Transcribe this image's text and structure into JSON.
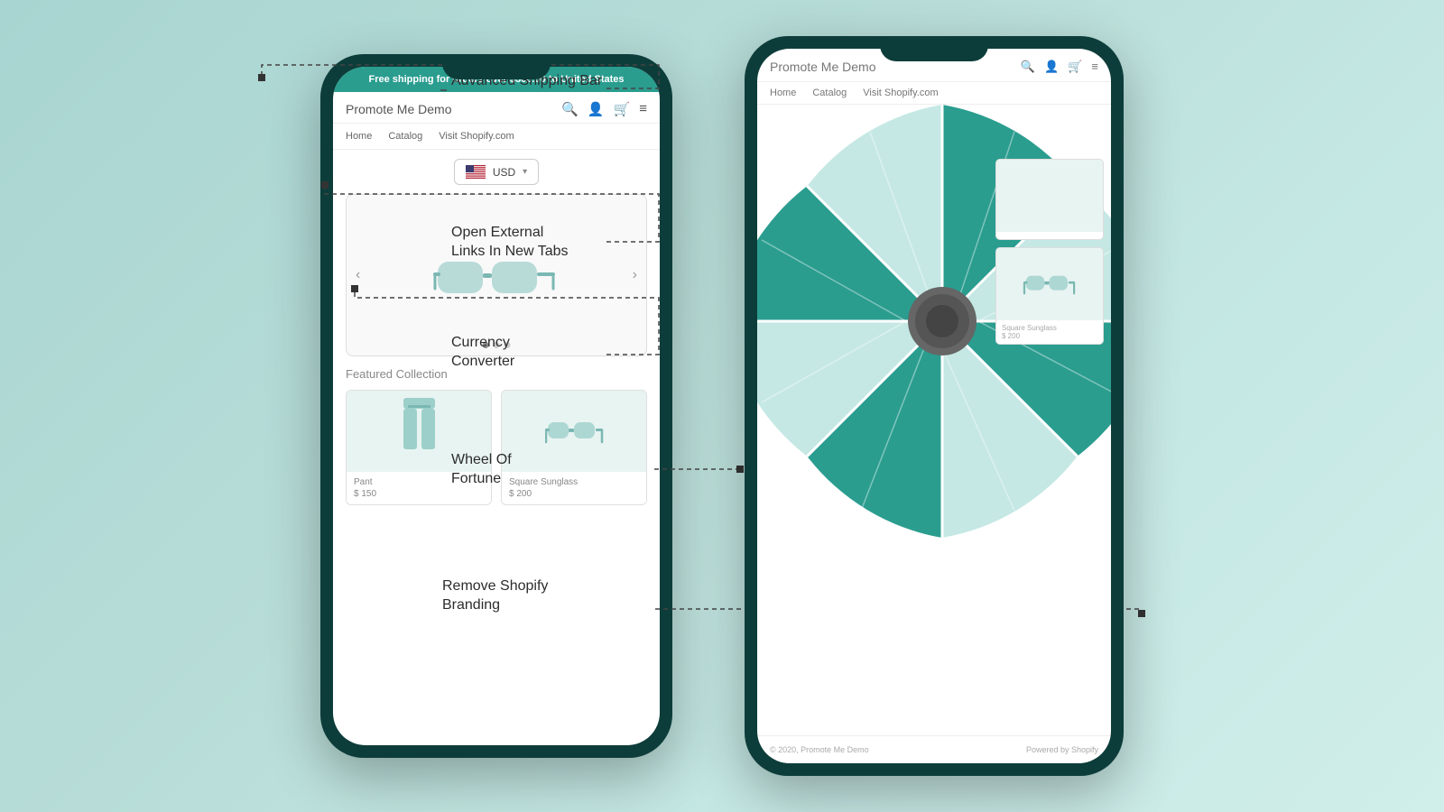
{
  "background": {
    "gradient_start": "#a8d5d1",
    "gradient_end": "#d0eeea"
  },
  "left_phone": {
    "shipping_bar": {
      "text_normal": "Free shipping for orders over ",
      "text_bold": "$300.00",
      "text_end": " to United States"
    },
    "store_title": "Promote Me Demo",
    "nav_items": [
      "Home",
      "Catalog",
      "Visit Shopify.com"
    ],
    "currency": {
      "code": "USD",
      "flag": "🇺🇸"
    },
    "slider_dots": 3,
    "featured_title": "Featured Collection",
    "products": [
      {
        "name": "Pant",
        "price": "$ 150"
      },
      {
        "name": "Square Sunglass",
        "price": "$ 200"
      }
    ]
  },
  "right_phone": {
    "store_title": "Promote Me Demo",
    "nav_items": [
      "Home",
      "Catalog",
      "Visit Shopify.com"
    ],
    "footer": {
      "copyright": "© 2020, Promote Me Demo",
      "powered": "Powered by Shopify"
    },
    "product_thumbs": [
      {
        "name": "",
        "price": ""
      },
      {
        "name": "Square Sunglass",
        "price": "$ 200"
      }
    ]
  },
  "annotations": [
    {
      "id": "shipping",
      "text": "Advanced\nShipping Bar"
    },
    {
      "id": "links",
      "text": "Open External\nLinks In New Tabs"
    },
    {
      "id": "currency",
      "text": "Currency\nConverter"
    },
    {
      "id": "wheel",
      "text": "Wheel Of\nFortune"
    },
    {
      "id": "branding",
      "text": "Remove Shopify\nBranding"
    }
  ],
  "wheel": {
    "segments": 8,
    "colors_dark": "#2a9d8f",
    "colors_light": "#b8e0dc",
    "pointer_color": "#666"
  }
}
